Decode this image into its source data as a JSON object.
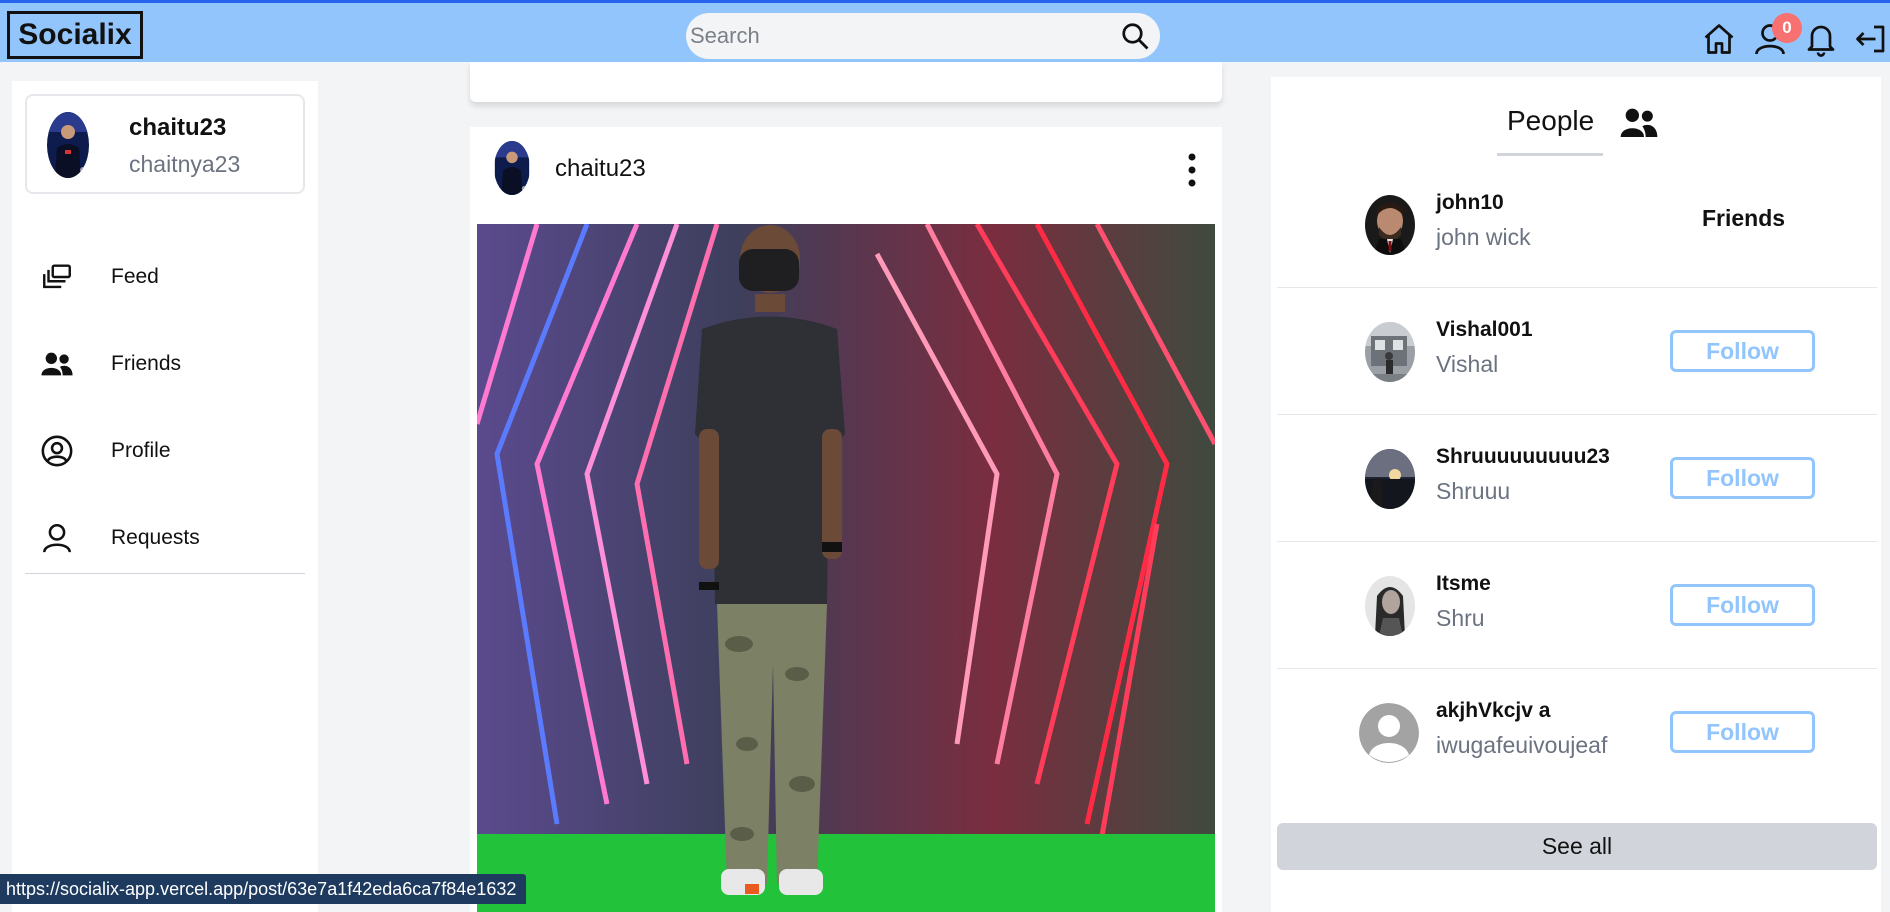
{
  "header": {
    "logo": "Socialix",
    "search_placeholder": "Search",
    "notification_count": "0",
    "icons": [
      "home-icon",
      "user-icon",
      "bell-icon",
      "logout-icon"
    ]
  },
  "sidebar": {
    "user": {
      "name": "chaitu23",
      "handle": "chaitnya23"
    },
    "items": [
      {
        "label": "Feed",
        "icon": "feed-icon"
      },
      {
        "label": "Friends",
        "icon": "friends-icon"
      },
      {
        "label": "Profile",
        "icon": "profile-icon"
      },
      {
        "label": "Requests",
        "icon": "requests-icon"
      }
    ]
  },
  "post": {
    "author": "chaitu23"
  },
  "people": {
    "tab_label": "People",
    "rows": [
      {
        "username": "john10",
        "name": "john wick",
        "status": "Friends"
      },
      {
        "username": "Vishal001",
        "name": "Vishal",
        "action": "Follow"
      },
      {
        "username": "Shruuuuuuuuu23",
        "name": "Shruuu",
        "action": "Follow"
      },
      {
        "username": "Itsme",
        "name": "Shru",
        "action": "Follow"
      },
      {
        "username": "akjhVkcjv a",
        "name": "iwugafeuivoujeaf",
        "action": "Follow"
      }
    ],
    "see_all_label": "See all"
  },
  "status_link": "https://socialix-app.vercel.app/post/63e7a1f42eda6ca7f84e1632",
  "colors": {
    "header_bg": "#93c5fd",
    "follow_accent": "#93c5fd",
    "badge": "#f87171"
  }
}
